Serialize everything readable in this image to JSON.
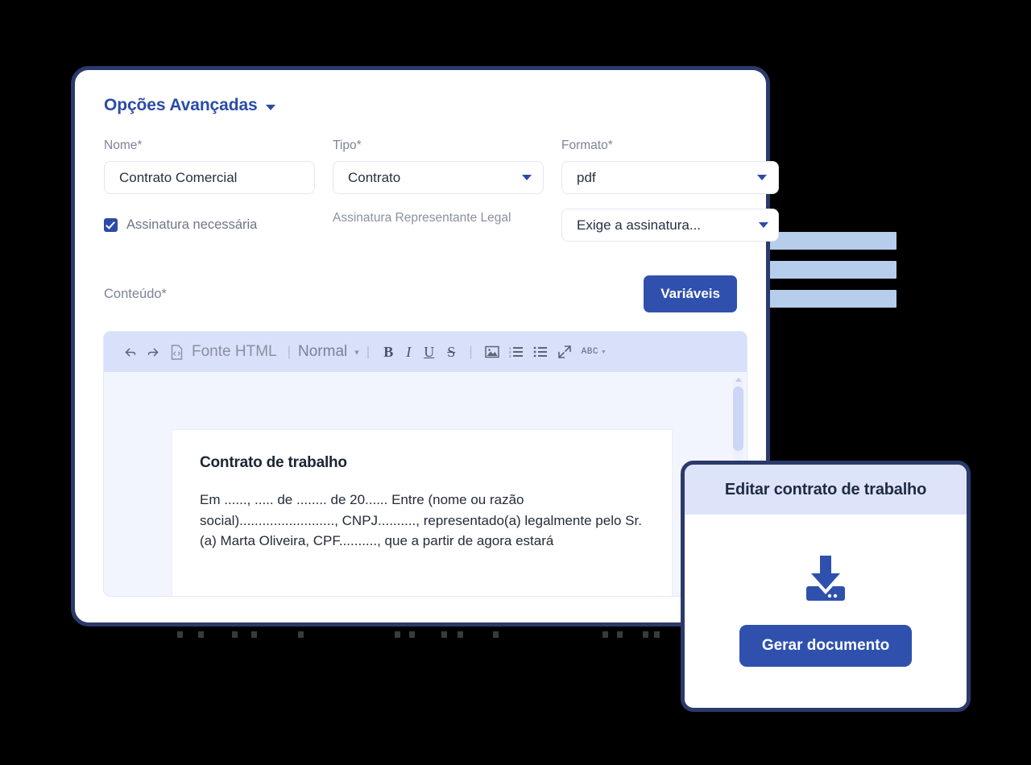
{
  "window": {
    "section_title": "Opções Avançadas",
    "caret_icon": "chevron-down-icon"
  },
  "form": {
    "fields": [
      {
        "label": "Nome*",
        "value": "Contrato Comercial",
        "type": "text"
      },
      {
        "label": "Tipo*",
        "value": "Contrato",
        "type": "select"
      },
      {
        "label": "Formato*",
        "value": "pdf",
        "type": "select"
      }
    ],
    "checkbox": {
      "label": "Assinatura necessária",
      "checked": true
    },
    "signature_label": "Assinatura Representante Legal",
    "signature_select": {
      "value": "Exige a assinatura...",
      "caret_icon": "chevron-down-icon"
    }
  },
  "content": {
    "label": "Conteúdo*",
    "variables_button": "Variáveis"
  },
  "editor": {
    "toolbar": {
      "undo_icon": "undo-arrow-icon",
      "redo_icon": "redo-arrow-icon",
      "source_icon": "html-source-file-icon",
      "source_label": "Fonte HTML",
      "separator": "|",
      "style_value": "Normal",
      "style_caret_icon": "chevron-down-icon",
      "bold": "B",
      "italic": "I",
      "underline": "U",
      "strikethrough": "S",
      "image_icon": "image-icon",
      "ordered_list_icon": "numbered-list-icon",
      "unordered_list_icon": "bullet-list-icon",
      "fullscreen_icon": "expand-fullscreen-icon",
      "spellcheck_label": "ABC",
      "spellcheck_caret_icon": "chevron-down-icon"
    },
    "document": {
      "title": "Contrato de trabalho",
      "paragraph": "Em ......, ..... de ........ de 20...... Entre (nome ou razão social)........................., CNPJ.........., representado(a) legalmente pelo Sr.(a) Marta Oliveira, CPF.........., que a partir de agora estará"
    },
    "scrollbar": {
      "up_arrow_icon": "scroll-up-arrow-icon"
    }
  },
  "modal": {
    "title": "Editar contrato de trabalho",
    "download_icon": "download-tray-icon",
    "generate_button": "Gerar documento"
  },
  "colors": {
    "brand_blue": "#2f51ad",
    "title_blue": "#2b4ba6",
    "card_border": "#2b3a6b",
    "toolbar_bg": "#d9e0fa",
    "editor_bg": "#f3f5fe",
    "modal_header_bg": "#dde4fa",
    "decor_bar": "#b6cdeb",
    "page_bg": "#000000"
  },
  "decor": {
    "bars": [
      1,
      2,
      3
    ]
  }
}
